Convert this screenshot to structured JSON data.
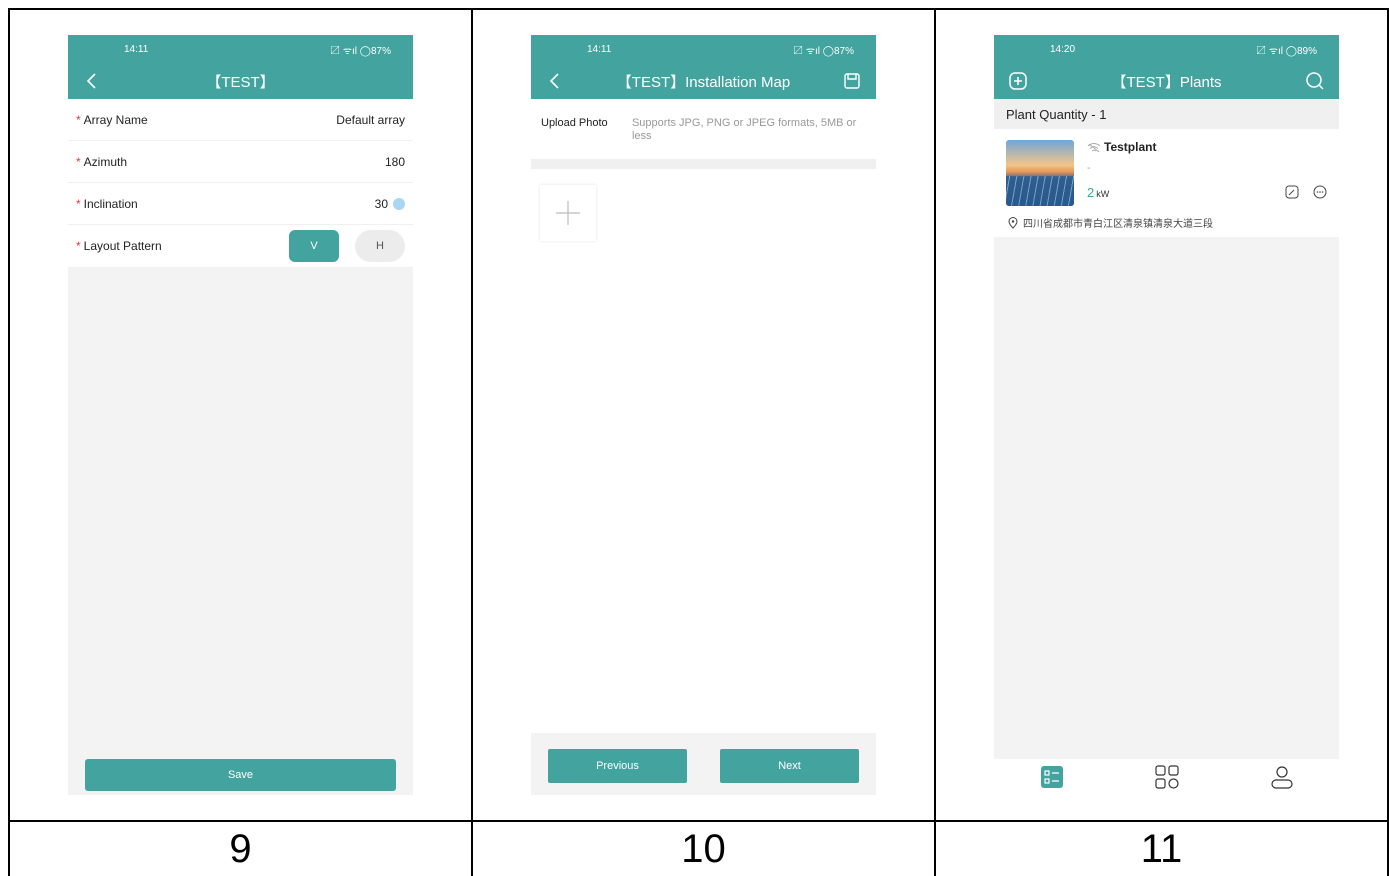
{
  "cell_labels": [
    "9",
    "10",
    "11"
  ],
  "screens": {
    "array_form": {
      "status_time": "14:11",
      "status_right": "〼 ᯤıl ◯87%",
      "title": "【TEST】",
      "fields": [
        {
          "label": "Array Name",
          "value": "Default array"
        },
        {
          "label": "Azimuth",
          "value": "180"
        },
        {
          "label": "Inclination",
          "value": "30"
        }
      ],
      "required_mark": "*",
      "layout_label": "Layout Pattern",
      "layout_options": [
        "V",
        "H"
      ],
      "save_label": "Save"
    },
    "installation_map": {
      "status_time": "14:11",
      "status_right": "〼 ᯤıl ◯87%",
      "title": "【TEST】Installation Map",
      "upload_label": "Upload Photo",
      "upload_hint": "Supports JPG, PNG or JPEG formats, 5MB or less",
      "previous_label": "Previous",
      "next_label": "Next"
    },
    "plants": {
      "status_time": "14:20",
      "status_right": "〼 ᯤıl ◯89%",
      "title": "【TEST】Plants",
      "quantity_label": "Plant Quantity - 1",
      "plant": {
        "name": "Testplant",
        "placeholder": "-",
        "power_value": "2",
        "power_unit": "kW",
        "address": "四川省成都市青白江区清泉镇清泉大道三段"
      }
    }
  },
  "colors": {
    "accent": "#43a39e",
    "required": "#e03a3a"
  },
  "icons": [
    "chevron-left-icon",
    "save-icon",
    "add-circle-icon",
    "search-icon",
    "plus-icon",
    "no-signal-icon",
    "location-pin-icon",
    "edit-icon",
    "more-icon",
    "list-tab-icon",
    "grid-tab-icon",
    "user-tab-icon"
  ]
}
